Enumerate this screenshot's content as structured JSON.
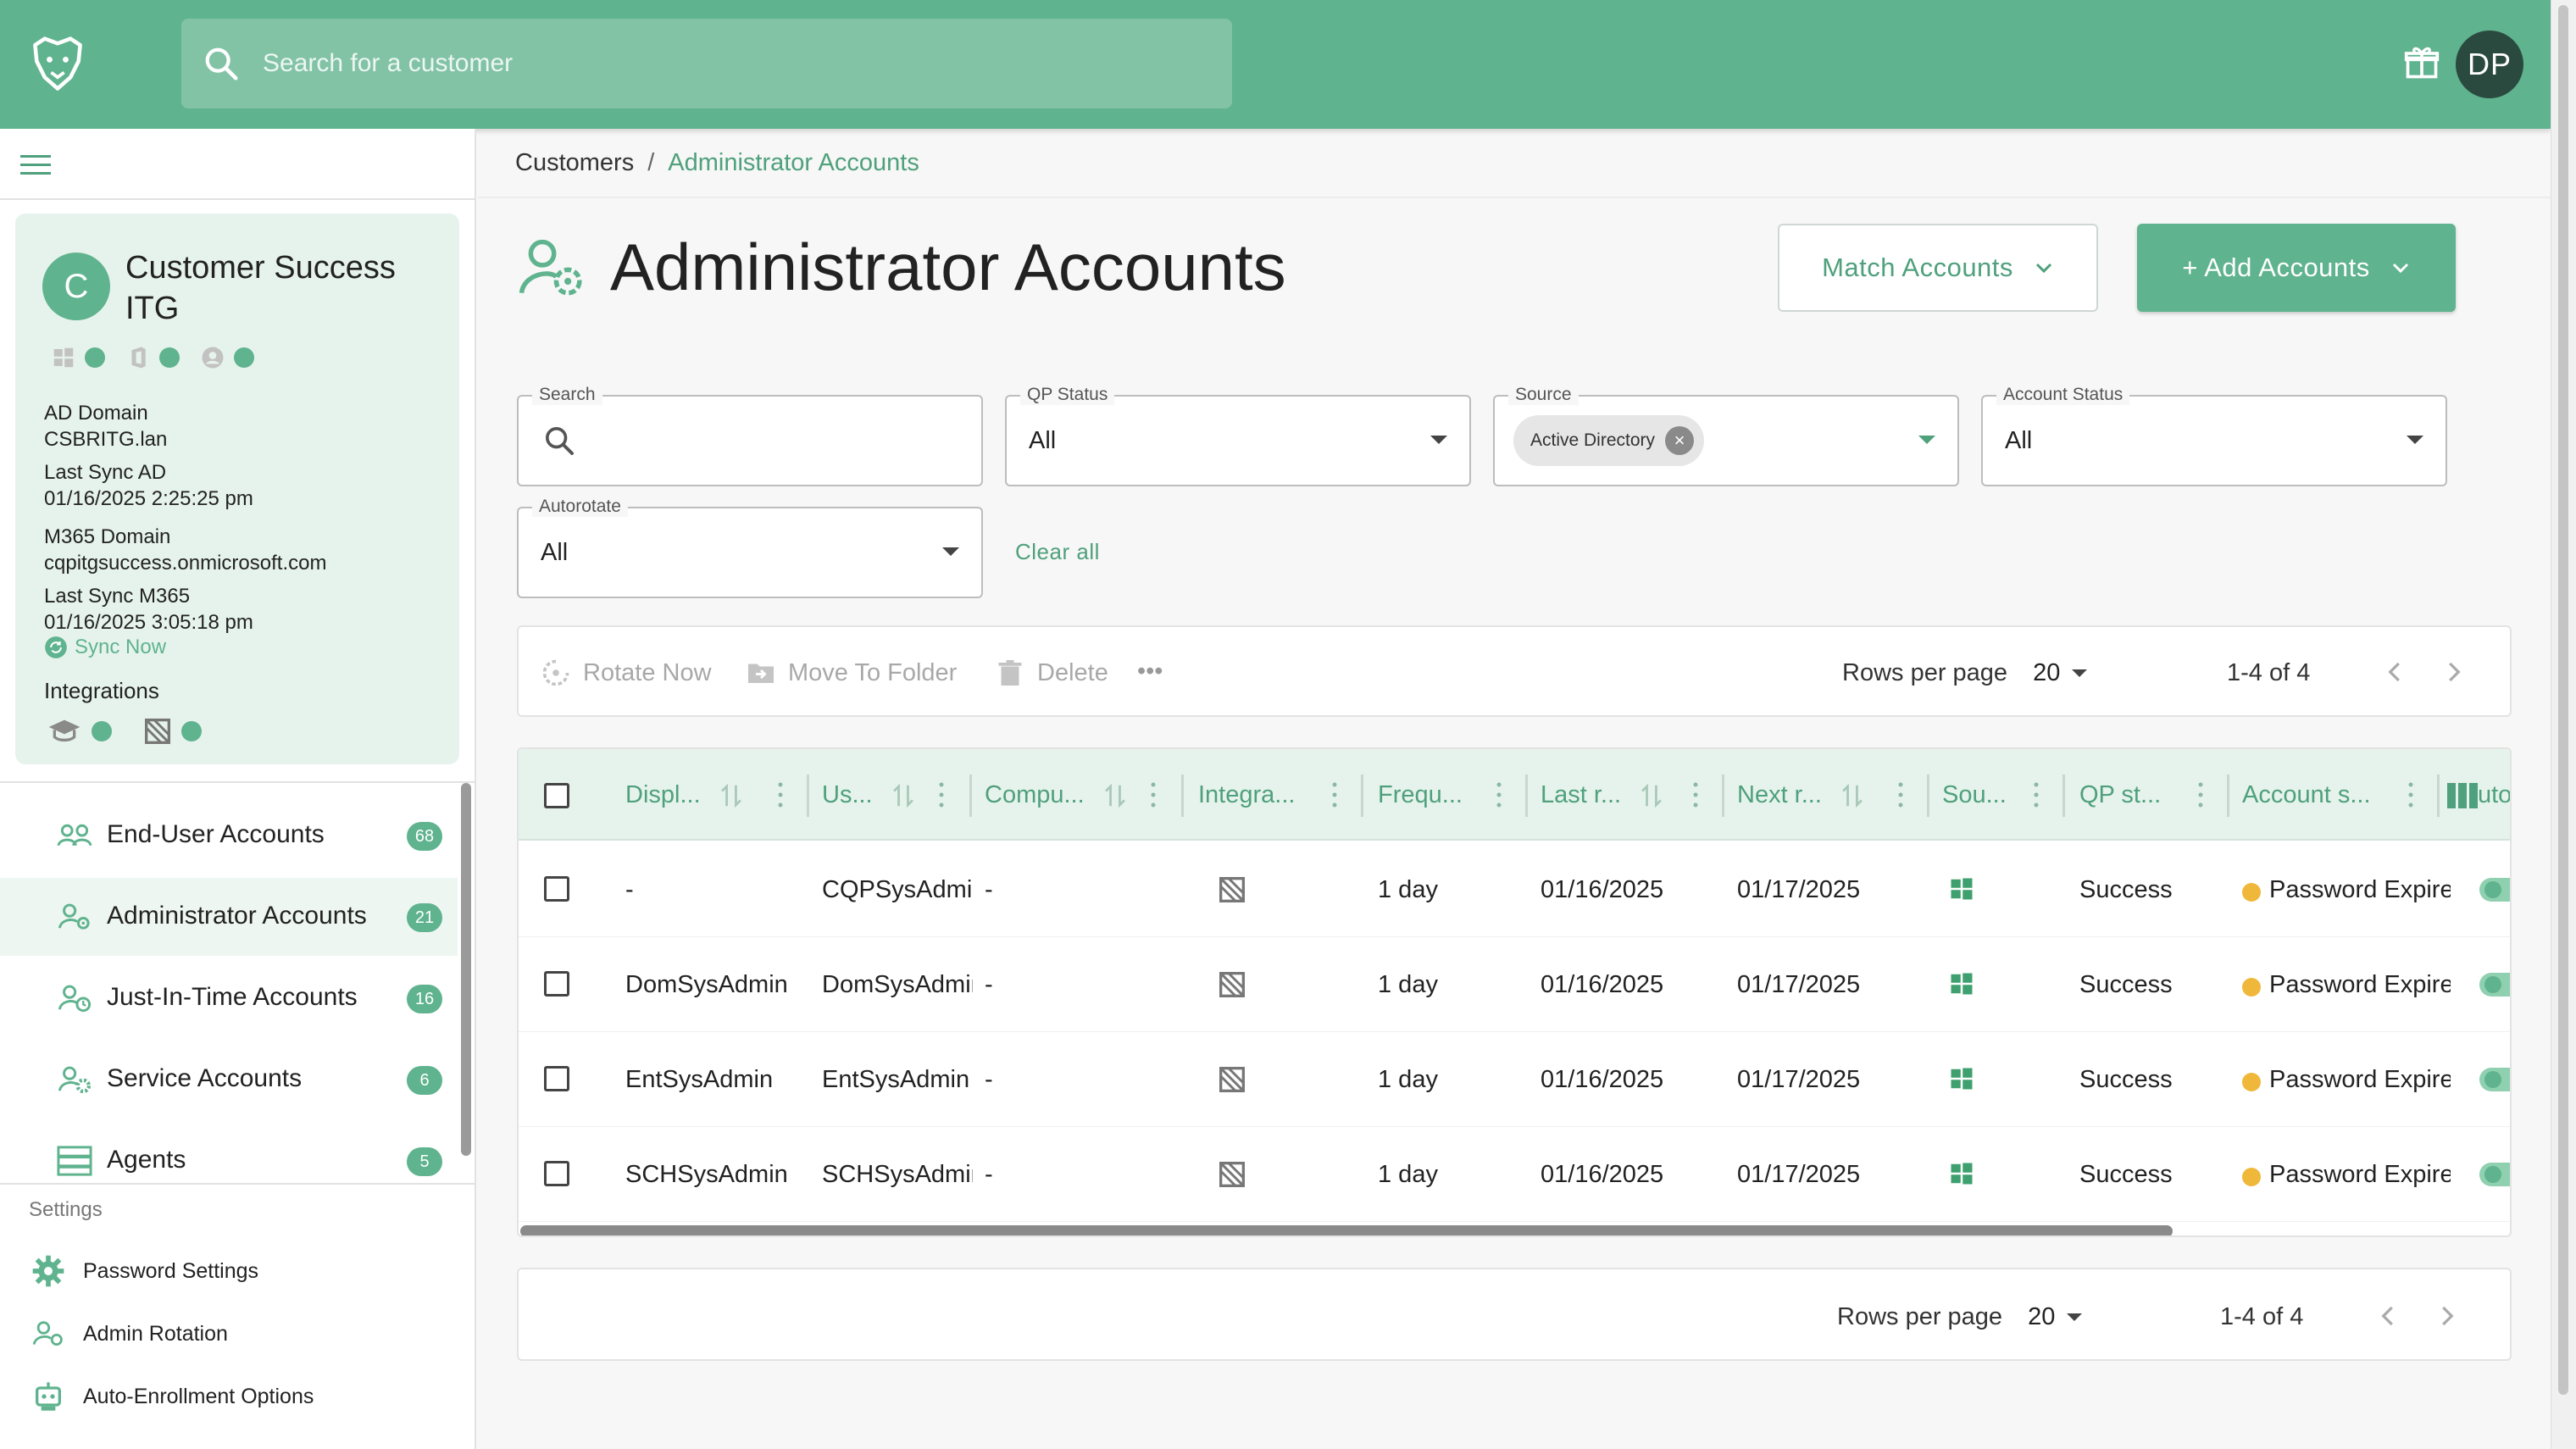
{
  "header": {
    "search_placeholder": "Search for a customer",
    "user_initials": "DP"
  },
  "customer": {
    "initial": "C",
    "name": "Customer Success ITG",
    "ad_domain_label": "AD Domain",
    "ad_domain": "CSBRITG.lan",
    "last_sync_ad_label": "Last Sync AD",
    "last_sync_ad": "01/16/2025 2:25:25 pm",
    "m365_domain_label": "M365 Domain",
    "m365_domain": "cqpitgsuccess.onmicrosoft.com",
    "last_sync_m365_label": "Last Sync M365",
    "last_sync_m365": "01/16/2025 3:05:18 pm",
    "sync_now": "Sync Now",
    "integrations_label": "Integrations"
  },
  "nav": {
    "items": [
      {
        "label": "End-User Accounts",
        "count": "68"
      },
      {
        "label": "Administrator Accounts",
        "count": "21"
      },
      {
        "label": "Just-In-Time Accounts",
        "count": "16"
      },
      {
        "label": "Service Accounts",
        "count": "6"
      },
      {
        "label": "Agents",
        "count": "5"
      }
    ],
    "settings_label": "Settings",
    "settings_items": [
      {
        "label": "Password Settings"
      },
      {
        "label": "Admin Rotation"
      },
      {
        "label": "Auto-Enrollment Options"
      }
    ]
  },
  "breadcrumb": {
    "root": "Customers",
    "separator": "/",
    "current": "Administrator Accounts"
  },
  "page": {
    "title": "Administrator Accounts",
    "match_button": "Match Accounts",
    "add_button": "+ Add Accounts"
  },
  "filters": {
    "search_label": "Search",
    "qp_status_label": "QP Status",
    "qp_status_value": "All",
    "source_label": "Source",
    "source_chip": "Active Directory",
    "account_status_label": "Account Status",
    "account_status_value": "All",
    "autorotate_label": "Autorotate",
    "autorotate_value": "All",
    "clear_all": "Clear all"
  },
  "toolbar": {
    "rotate_now": "Rotate Now",
    "move_to_folder": "Move To Folder",
    "delete": "Delete",
    "more": "•••",
    "rows_per_page_label": "Rows per page",
    "rows_per_page": "20",
    "range": "1-4 of 4"
  },
  "table": {
    "columns": [
      "Displ...",
      "Us...",
      "Compu...",
      "Integra...",
      "Frequ...",
      "Last r...",
      "Next r...",
      "Sou...",
      "QP st...",
      "Account s...",
      "uto"
    ],
    "rows": [
      {
        "display": "-",
        "user": "CQPSysAdmin",
        "computer": "-",
        "frequency": "1 day",
        "last": "01/16/2025",
        "next": "01/17/2025",
        "qp_status": "Success",
        "account_status": "Password Expired"
      },
      {
        "display": "DomSysAdmin",
        "user": "DomSysAdmin",
        "computer": "-",
        "frequency": "1 day",
        "last": "01/16/2025",
        "next": "01/17/2025",
        "qp_status": "Success",
        "account_status": "Password Expired"
      },
      {
        "display": "EntSysAdmin",
        "user": "EntSysAdmin",
        "computer": "-",
        "frequency": "1 day",
        "last": "01/16/2025",
        "next": "01/17/2025",
        "qp_status": "Success",
        "account_status": "Password Expired"
      },
      {
        "display": "SCHSysAdmin",
        "user": "SCHSysAdmin",
        "computer": "-",
        "frequency": "1 day",
        "last": "01/16/2025",
        "next": "01/17/2025",
        "qp_status": "Success",
        "account_status": "Password Expired"
      }
    ]
  },
  "footer": {
    "rows_per_page_label": "Rows per page",
    "rows_per_page": "20",
    "range": "1-4 of 4"
  },
  "colors": {
    "brand": "#5fb38e",
    "brand_dark": "#4fa07c",
    "warning": "#f0b83a"
  },
  "icons": {
    "logo": "leopard-logo-icon",
    "search": "search-icon",
    "gift": "gift-icon",
    "menu": "hamburger-icon",
    "windows": "windows-icon",
    "integration": "integration-icon"
  }
}
